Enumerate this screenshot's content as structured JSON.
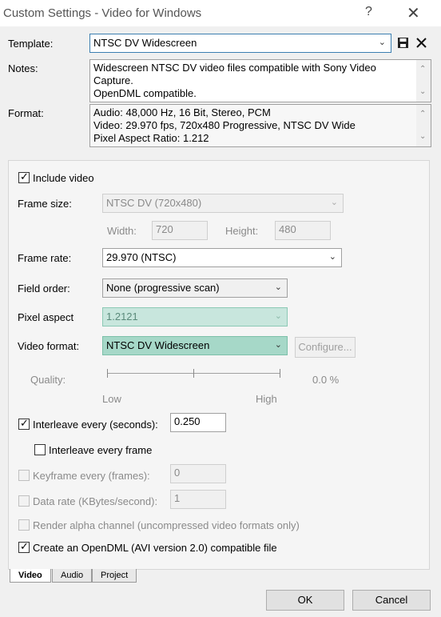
{
  "window": {
    "title": "Custom Settings - Video for Windows",
    "help_glyph": "?",
    "close_glyph": "✕"
  },
  "template": {
    "label": "Template:",
    "value": "NTSC DV Widescreen"
  },
  "notes": {
    "label": "Notes:",
    "lines": [
      "Widescreen NTSC DV video files compatible with Sony Video",
      "Capture.",
      "OpenDML compatible."
    ]
  },
  "format": {
    "label": "Format:",
    "lines": [
      "Audio: 48,000 Hz, 16 Bit, Stereo, PCM",
      "Video: 29.970 fps, 720x480 Progressive, NTSC DV Wide",
      "Pixel Aspect Ratio: 1.212"
    ]
  },
  "video": {
    "include_label": "Include video",
    "frame_size": {
      "label": "Frame size:",
      "value": "NTSC DV (720x480)"
    },
    "width": {
      "label": "Width:",
      "value": "720"
    },
    "height": {
      "label": "Height:",
      "value": "480"
    },
    "frame_rate": {
      "label": "Frame rate:",
      "value": "29.970 (NTSC)"
    },
    "field_order": {
      "label": "Field order:",
      "value": "None (progressive scan)"
    },
    "pixel_aspect": {
      "label": "Pixel aspect",
      "value": "1.2121"
    },
    "video_format": {
      "label": "Video format:",
      "value": "NTSC DV Widescreen"
    },
    "configure": "Configure...",
    "quality": {
      "label": "Quality:",
      "low": "Low",
      "high": "High",
      "value": "0.0 %"
    },
    "interleave": {
      "label": "Interleave every (seconds):",
      "value": "0.250"
    },
    "interleave_frame": "Interleave every frame",
    "keyframe": {
      "label": "Keyframe every (frames):",
      "value": "0"
    },
    "data_rate": {
      "label": "Data rate (KBytes/second):",
      "value": "1"
    },
    "render_alpha": "Render alpha channel (uncompressed video formats only)",
    "opendml": "Create an OpenDML (AVI version 2.0) compatible file"
  },
  "tabs": [
    "Video",
    "Audio",
    "Project"
  ],
  "buttons": {
    "ok": "OK",
    "cancel": "Cancel"
  },
  "colors": {
    "highlight": "#c8e6dd",
    "highlight_strong": "#a6d8c8"
  }
}
